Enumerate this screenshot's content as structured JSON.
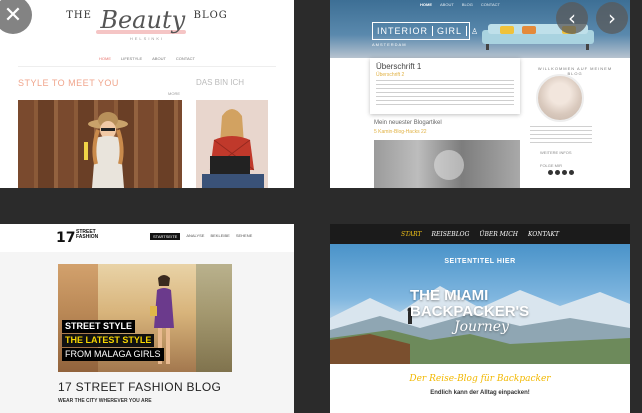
{
  "overlay": {
    "close_glyph": "✕",
    "prev_glyph": "‹",
    "next_glyph": "›"
  },
  "tile_beauty": {
    "logo_the": "THE",
    "logo_beauty": "Beauty",
    "logo_blog": "BLOG",
    "tagline": "HELSINKI",
    "menu": [
      "HOME",
      "LIFESTYLE",
      "ABOUT",
      "CONTACT"
    ],
    "section_left": "STYLE TO MEET YOU",
    "section_right": "DAS BIN ICH",
    "mini_link": "MORE",
    "accent": "#e8756f"
  },
  "tile_interior": {
    "nav": [
      "HOME",
      "ABOUT",
      "BLOG",
      "CONTACT"
    ],
    "brand_a": "INTERIOR",
    "brand_b": "GIRL",
    "brand_icon": "♙",
    "brand_sub": "AMSTERDAM",
    "card_heading": "Überschrift 1",
    "card_sub": "Überschrift 2",
    "side_label": "WILLKOMMEN AUF MEINEM BLOG",
    "side_label_2": "WEITERE INFOS",
    "side_label_3": "FOLGE MIR",
    "post_title": "Mein neuester Blogartikel",
    "post_meta": "5 Kamin-Blog-Hacks 22",
    "accent": "#e1b245"
  },
  "tile_street": {
    "logo_num": "17",
    "logo_text": "STREET FASHION",
    "nav": [
      "STARTSEITE",
      "ANALYSE",
      "BEKLEIBE",
      "SEHENE"
    ],
    "tag1": "STREET STYLE",
    "tag2": "THE LATEST STYLE",
    "tag3": "FROM MALAGA GIRLS",
    "title": "17 STREET FASHION BLOG",
    "subtitle": "WEAR THE CITY WHEREVER YOU ARE",
    "accent": "#f5d500"
  },
  "tile_miami": {
    "nav": [
      "START",
      "REISEBLOG",
      "ÜBER MICH",
      "KONTAKT"
    ],
    "seitentitel": "SEITENTITEL HIER",
    "big1": "THE MIAMI",
    "big2": "BACKPACKER'S",
    "script": "Journey",
    "bottom_l1": "Der Reise-Blog für Backpacker",
    "bottom_l2": "Endlich kann der Alltag einpacken!",
    "accent": "#f5c518"
  }
}
